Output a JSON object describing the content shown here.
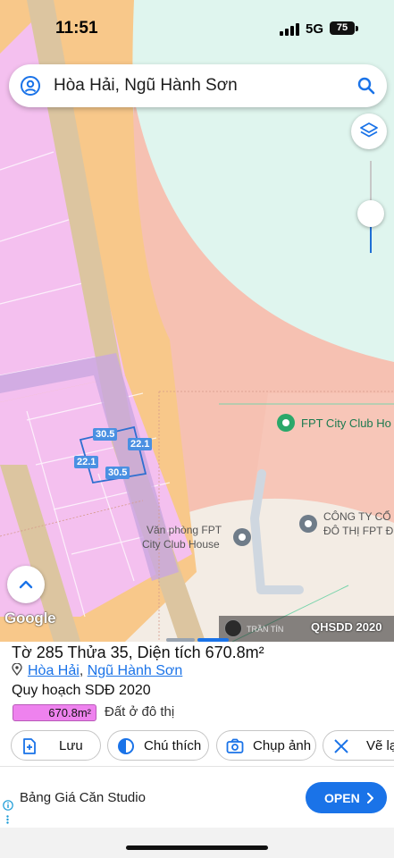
{
  "status_bar": {
    "time": "11:51",
    "network": "5G",
    "battery": "75"
  },
  "search": {
    "query": "Hòa Hải, Ngũ Hành Sơn"
  },
  "map": {
    "dimensions": {
      "top": "30.5",
      "right": "22.1",
      "left": "22.1",
      "bottom": "30.5"
    },
    "pois": {
      "fpt_club": "FPT City Club Ho",
      "office_line1": "Văn phòng FPT",
      "office_line2": "City Club House",
      "company_line1": "CÔNG TY CỔ",
      "company_line2": "ĐÔ THỊ FPT Đ"
    },
    "google_logo": "Google",
    "watermark": {
      "author": "TRẦN TÍN",
      "code": "QHSDD 2020"
    }
  },
  "info": {
    "title": "Tờ 285 Thửa 35, Diện tích 670.8m²",
    "location_ward": "Hòa Hải",
    "location_separator": ",",
    "location_district": "Ngũ Hành Sơn",
    "plan": "Quy hoạch SDĐ 2020",
    "area_badge": "670.8m²",
    "land_use": "Đất ở đô thị"
  },
  "actions": {
    "save": "Lưu",
    "legend": "Chú thích",
    "capture": "Chụp ảnh",
    "draw": "Vẽ lạ"
  },
  "ad": {
    "title": "Bảng Giá Căn Studio",
    "open": "OPEN"
  },
  "colors": {
    "accent": "#1a73e8",
    "land_pink": "#f4c0ef",
    "road_orange": "#f8c88a",
    "salmon": "#f6c1b2",
    "mint": "#dff5ee"
  }
}
